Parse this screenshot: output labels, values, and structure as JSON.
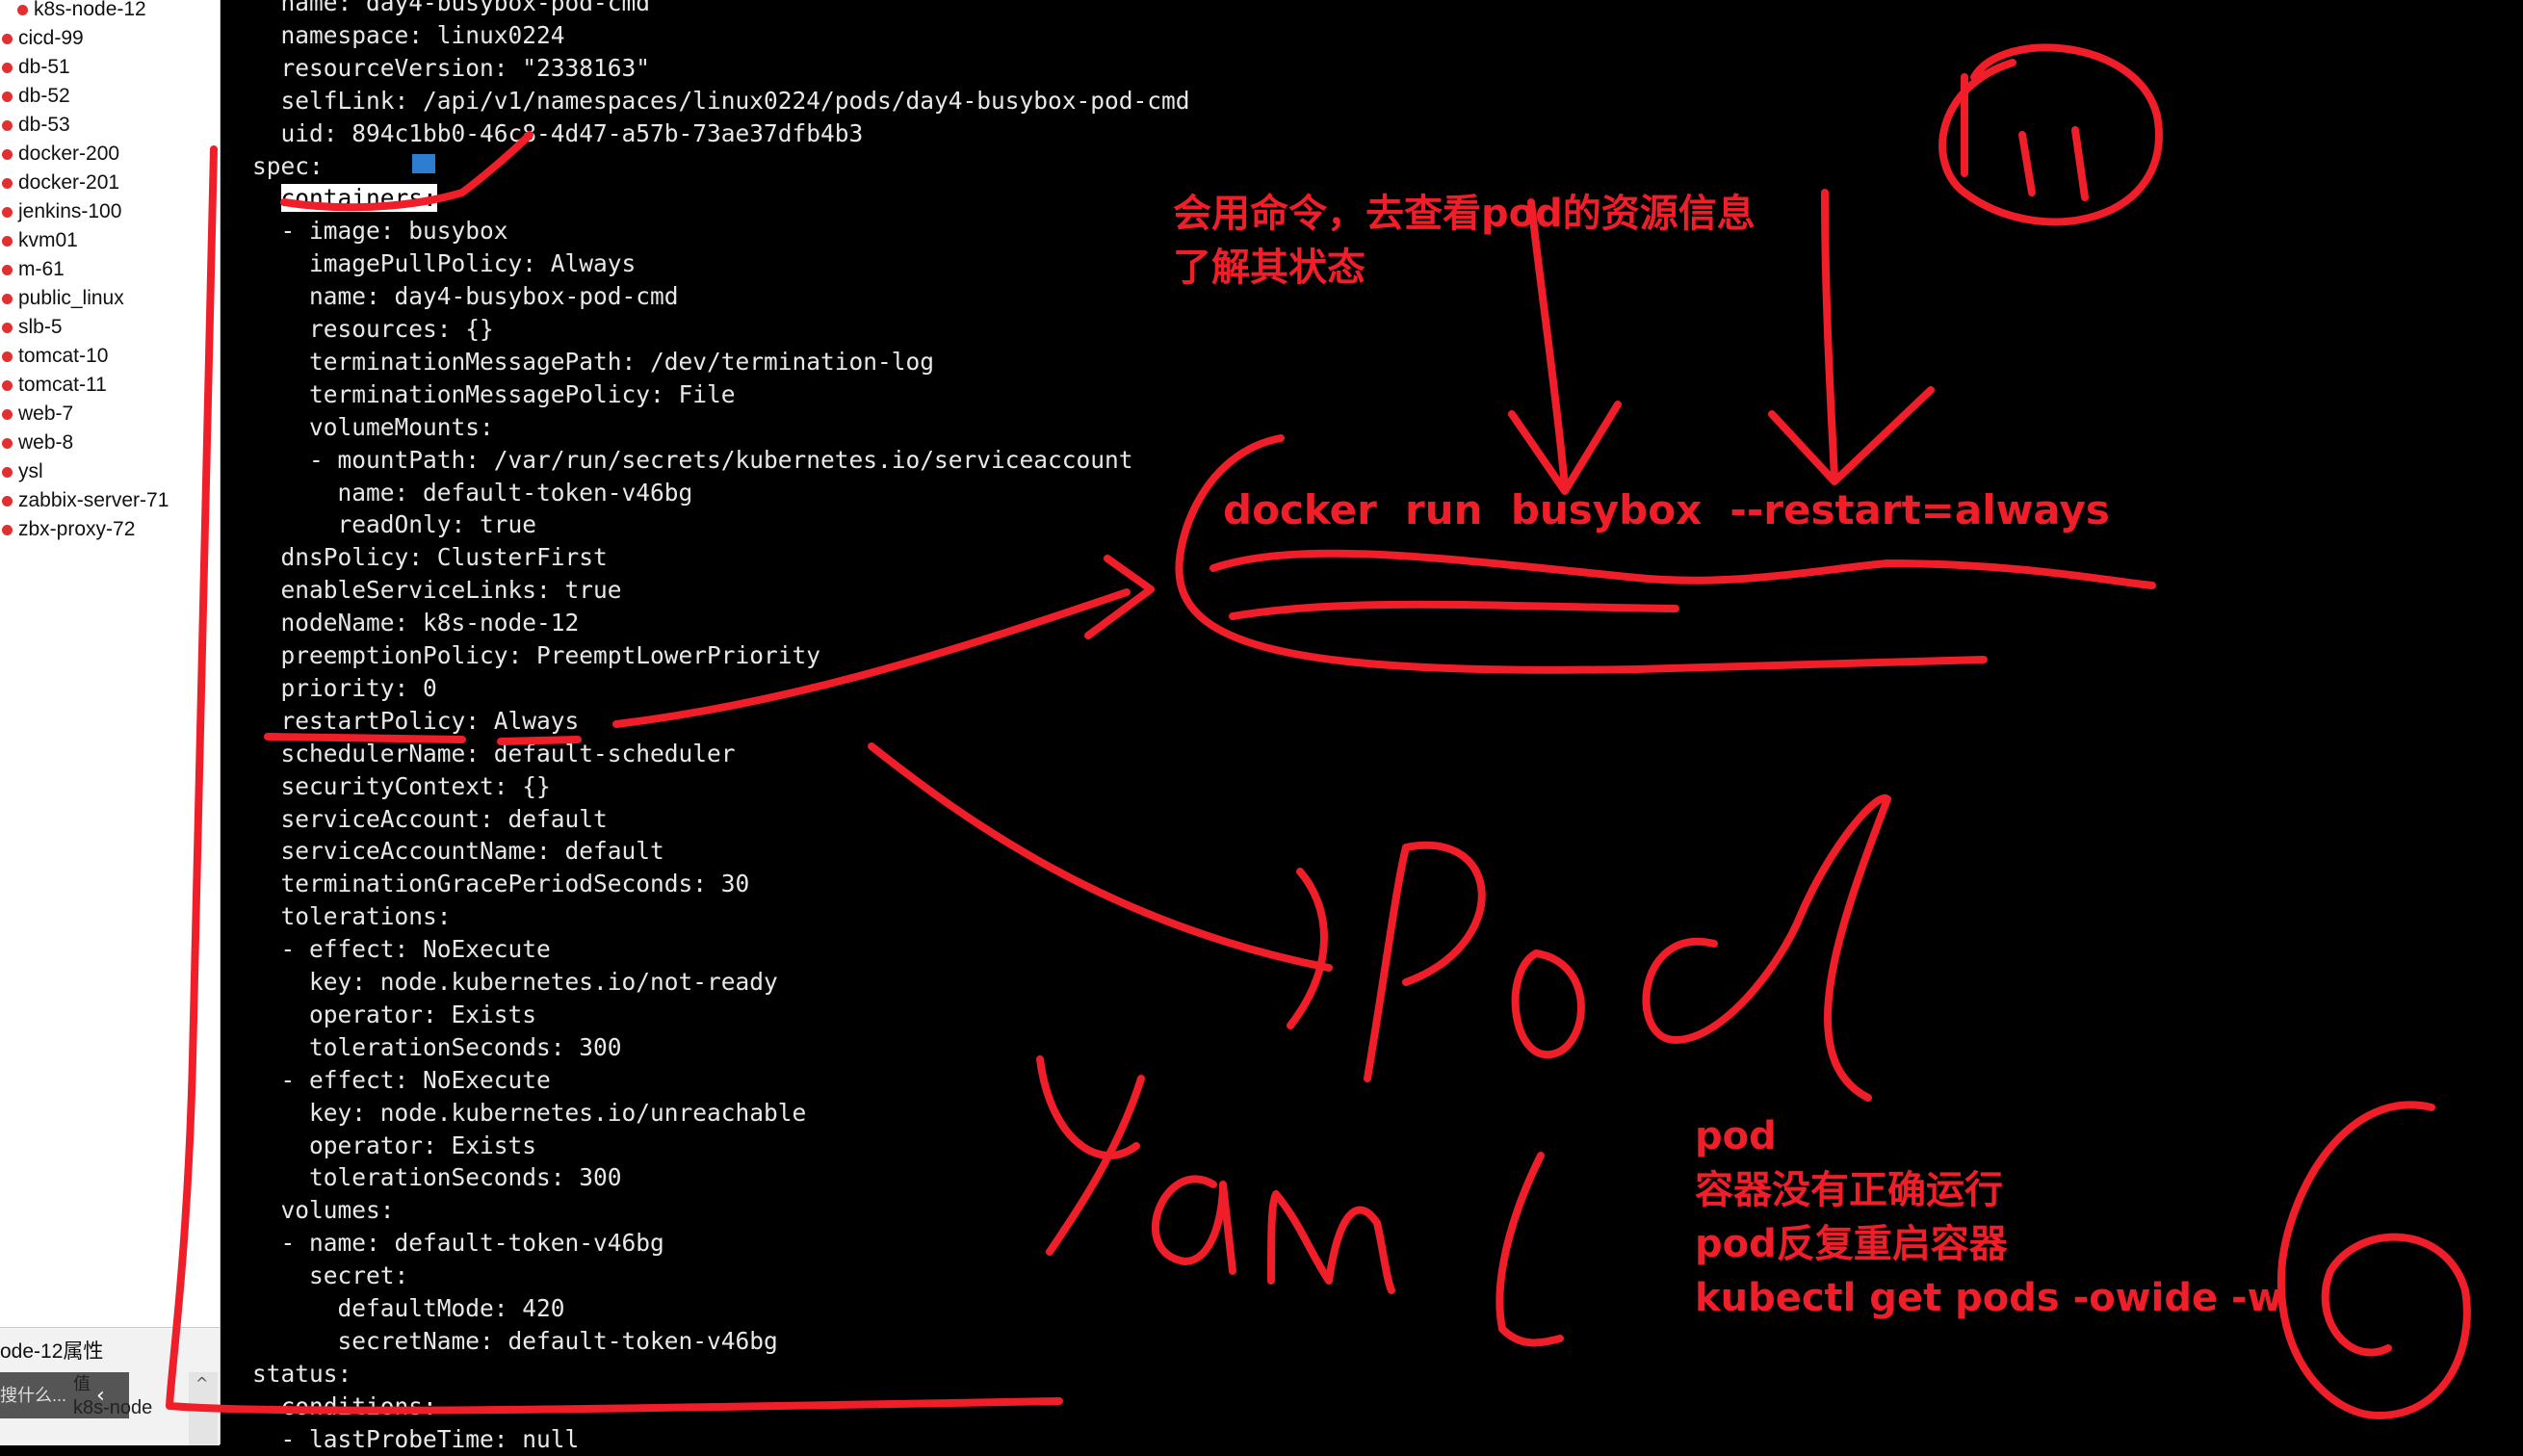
{
  "sidebar": {
    "sessions": [
      {
        "name": "k8s-node-12"
      },
      {
        "name": "cicd-99"
      },
      {
        "name": "db-51"
      },
      {
        "name": "db-52"
      },
      {
        "name": "db-53"
      },
      {
        "name": "docker-200"
      },
      {
        "name": "docker-201"
      },
      {
        "name": "jenkins-100"
      },
      {
        "name": "kvm01"
      },
      {
        "name": "m-61"
      },
      {
        "name": "public_linux"
      },
      {
        "name": "slb-5"
      },
      {
        "name": "tomcat-10"
      },
      {
        "name": "tomcat-11"
      },
      {
        "name": "web-7"
      },
      {
        "name": "web-8"
      },
      {
        "name": "ysl"
      },
      {
        "name": "zabbix-server-71"
      },
      {
        "name": "zbx-proxy-72"
      }
    ],
    "properties": {
      "title": "ode-12属性",
      "search_placeholder": "搜什么...",
      "value_header": "值",
      "value": "k8s-node"
    }
  },
  "terminal": {
    "lines": [
      "  name: day4-busybox-pod-cmd",
      "  namespace: linux0224",
      "  resourceVersion: \"2338163\"",
      "  selfLink: /api/v1/namespaces/linux0224/pods/day4-busybox-pod-cmd",
      "  uid: 894c1bb0-46c8-4d47-a57b-73ae37dfb4b3",
      "spec:",
      "  containers:",
      "  - image: busybox",
      "    imagePullPolicy: Always",
      "    name: day4-busybox-pod-cmd",
      "    resources: {}",
      "    terminationMessagePath: /dev/termination-log",
      "    terminationMessagePolicy: File",
      "    volumeMounts:",
      "    - mountPath: /var/run/secrets/kubernetes.io/serviceaccount",
      "      name: default-token-v46bg",
      "      readOnly: true",
      "  dnsPolicy: ClusterFirst",
      "  enableServiceLinks: true",
      "  nodeName: k8s-node-12",
      "  preemptionPolicy: PreemptLowerPriority",
      "  priority: 0",
      "  restartPolicy: Always",
      "  schedulerName: default-scheduler",
      "  securityContext: {}",
      "  serviceAccount: default",
      "  serviceAccountName: default",
      "  terminationGracePeriodSeconds: 30",
      "  tolerations:",
      "  - effect: NoExecute",
      "    key: node.kubernetes.io/not-ready",
      "    operator: Exists",
      "    tolerationSeconds: 300",
      "  - effect: NoExecute",
      "    key: node.kubernetes.io/unreachable",
      "    operator: Exists",
      "    tolerationSeconds: 300",
      "  volumes:",
      "  - name: default-token-v46bg",
      "    secret:",
      "      defaultMode: 420",
      "      secretName: default-token-v46bg",
      "status:",
      "  conditions:",
      "  - lastProbeTime: null"
    ]
  },
  "annotations": {
    "accent_color": "#f01e28",
    "note1_line1": "会用命令，去查看pod的资源信息",
    "note1_line2": "了解其状态",
    "docker_cmd": "docker  run  busybox  --restart=always",
    "pod_word": "Pod",
    "yaml_word": "Yaml",
    "number_top": "111",
    "number_bottom": "6",
    "note2": [
      "pod",
      "容器没有正确运行",
      "pod反复重启容器",
      "kubectl get pods -owide -w"
    ]
  }
}
